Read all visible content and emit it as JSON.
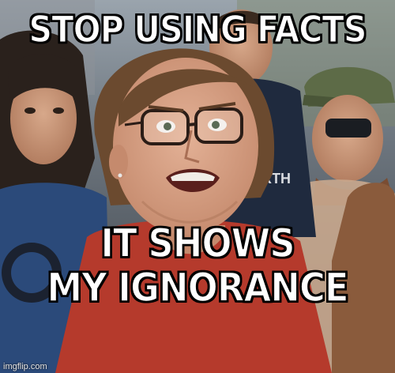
{
  "meme": {
    "top_text": "STOP USING FACTS",
    "bottom_text_line1": "IT SHOWS",
    "bottom_text_line2": "MY IGNORANCE",
    "watermark": "imgflip.com"
  },
  "colors": {
    "caption": "#ffffff",
    "caption_outline": "#000000",
    "shirt_red": "#b53a2c",
    "hair_brown": "#6b4a2f",
    "skin": "#d9a488",
    "background_crowd": "#3a3f45",
    "cap_camo": "#5d6b47",
    "sunglasses": "#1a1d22"
  }
}
